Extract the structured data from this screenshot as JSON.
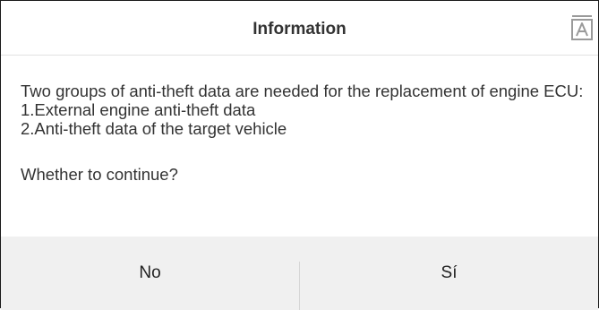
{
  "dialog": {
    "title": "Information",
    "header_icon": "font-size-icon",
    "message_lines": [
      "Two groups of anti-theft data are needed for the replacement of engine ECU:",
      "1.External engine anti-theft data",
      "2.Anti-theft data of the target vehicle"
    ],
    "question": "Whether to continue?",
    "buttons": {
      "no": "No",
      "yes": "Sí"
    }
  },
  "colors": {
    "footer_background": "#f0f0f0",
    "text": "#333333",
    "divider": "#d6d6d6"
  }
}
